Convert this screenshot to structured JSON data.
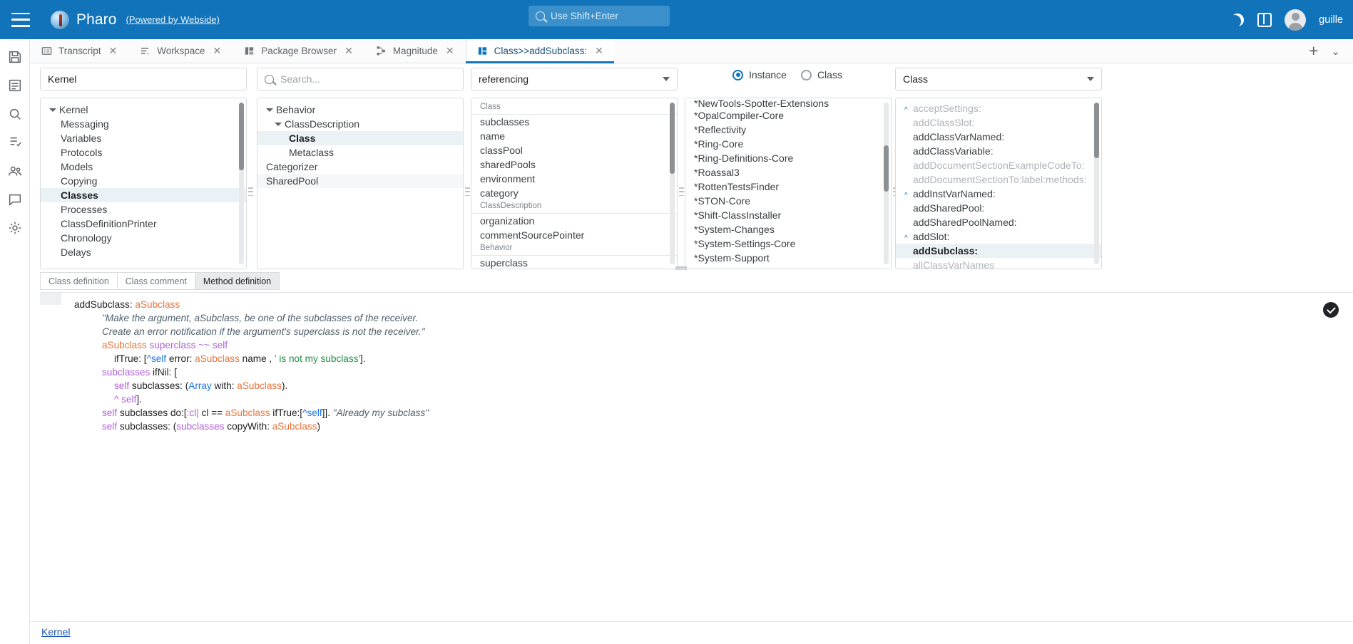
{
  "topbar": {
    "menu_icon": "hamburger-icon",
    "brand": "Pharo",
    "brand_sub": "(Powered by Webside)",
    "search_placeholder": "Use Shift+Enter",
    "dark_mode_icon": "moon-icon",
    "layout_icon": "split-pane-icon",
    "username": "guille"
  },
  "rail": {
    "items": [
      {
        "name": "save-icon",
        "label": "Save"
      },
      {
        "name": "book-icon",
        "label": "Changes"
      },
      {
        "name": "search-icon",
        "label": "Search"
      },
      {
        "name": "test-runner-icon",
        "label": "Test Runner"
      },
      {
        "name": "users-icon",
        "label": "Peers"
      },
      {
        "name": "chat-icon",
        "label": "Chat"
      },
      {
        "name": "gear-icon",
        "label": "Settings"
      }
    ]
  },
  "tabs": {
    "items": [
      {
        "label": "Transcript",
        "icon": "transcript-icon",
        "active": false
      },
      {
        "label": "Workspace",
        "icon": "workspace-icon",
        "active": false
      },
      {
        "label": "Package Browser",
        "icon": "package-browser-icon",
        "active": false
      },
      {
        "label": "Magnitude",
        "icon": "hierarchy-icon",
        "active": false
      },
      {
        "label": "Class>>addSubclass:",
        "icon": "class-browser-icon",
        "active": true
      }
    ],
    "close_label": "✕",
    "add_label": "+",
    "overflow_label": "⌄"
  },
  "browser": {
    "package_filter": {
      "value": "Kernel"
    },
    "class_search": {
      "value": "",
      "placeholder": "Search..."
    },
    "category_select": {
      "value": "referencing"
    },
    "side_select": {
      "value": "Class"
    },
    "side_options": [
      "Class",
      "Instance"
    ],
    "scope": {
      "instance_label": "Instance",
      "class_label": "Class",
      "selected": "Instance"
    },
    "packages": {
      "root": "Kernel",
      "items": [
        {
          "label": "Kernel",
          "level": 0,
          "expanded": true,
          "selected": false
        },
        {
          "label": "Messaging",
          "level": 1,
          "selected": false
        },
        {
          "label": "Variables",
          "level": 1,
          "selected": false
        },
        {
          "label": "Protocols",
          "level": 1,
          "selected": false
        },
        {
          "label": "Models",
          "level": 1,
          "selected": false
        },
        {
          "label": "Copying",
          "level": 1,
          "selected": false
        },
        {
          "label": "Classes",
          "level": 1,
          "selected": true
        },
        {
          "label": "Processes",
          "level": 1,
          "selected": false
        },
        {
          "label": "ClassDefinitionPrinter",
          "level": 1,
          "selected": false
        },
        {
          "label": "Chronology",
          "level": 1,
          "selected": false
        },
        {
          "label": "Delays",
          "level": 1,
          "selected": false
        }
      ]
    },
    "classes": {
      "items": [
        {
          "label": "Behavior",
          "level": 0,
          "expanded": true,
          "selected": false,
          "alt": false
        },
        {
          "label": "ClassDescription",
          "level": 1,
          "expanded": true,
          "selected": false,
          "alt": false
        },
        {
          "label": "Class",
          "level": 2,
          "selected": true,
          "alt": false
        },
        {
          "label": "Metaclass",
          "level": 2,
          "selected": false,
          "alt": false
        },
        {
          "label": "Categorizer",
          "level": 0,
          "selected": false,
          "alt": false
        },
        {
          "label": "SharedPool",
          "level": 0,
          "selected": false,
          "alt": true
        }
      ]
    },
    "variables": {
      "items": [
        {
          "label": "Class",
          "type": "header"
        },
        {
          "label": "subclasses",
          "type": "item"
        },
        {
          "label": "name",
          "type": "item"
        },
        {
          "label": "classPool",
          "type": "item"
        },
        {
          "label": "sharedPools",
          "type": "item"
        },
        {
          "label": "environment",
          "type": "item"
        },
        {
          "label": "category",
          "type": "item"
        },
        {
          "label": "ClassDescription",
          "type": "header"
        },
        {
          "label": "organization",
          "type": "item"
        },
        {
          "label": "commentSourcePointer",
          "type": "item"
        },
        {
          "label": "Behavior",
          "type": "header"
        },
        {
          "label": "superclass",
          "type": "item"
        }
      ]
    },
    "categories": {
      "items": [
        {
          "label": "*NewTools-Spotter-Extensions"
        },
        {
          "label": "*OpalCompiler-Core"
        },
        {
          "label": "*Reflectivity"
        },
        {
          "label": "*Ring-Core"
        },
        {
          "label": "*Ring-Definitions-Core"
        },
        {
          "label": "*Roassal3"
        },
        {
          "label": "*RottenTestsFinder"
        },
        {
          "label": "*STON-Core"
        },
        {
          "label": "*Shift-ClassInstaller"
        },
        {
          "label": "*System-Changes"
        },
        {
          "label": "*System-Settings-Core"
        },
        {
          "label": "*System-Support"
        }
      ]
    },
    "methods": {
      "items": [
        {
          "label": "acceptSettings:",
          "dim": true,
          "marker": "^"
        },
        {
          "label": "addClassSlot:",
          "dim": true,
          "marker": ""
        },
        {
          "label": "addClassVarNamed:",
          "dim": false,
          "marker": ""
        },
        {
          "label": "addClassVariable:",
          "dim": false,
          "marker": ""
        },
        {
          "label": "addDocumentSectionExampleCodeTo:",
          "dim": true,
          "marker": ""
        },
        {
          "label": "addDocumentSectionTo:label:methods:",
          "dim": true,
          "marker": ""
        },
        {
          "label": "addInstVarNamed:",
          "dim": false,
          "marker": "^"
        },
        {
          "label": "addSharedPool:",
          "dim": false,
          "marker": ""
        },
        {
          "label": "addSharedPoolNamed:",
          "dim": false,
          "marker": ""
        },
        {
          "label": "addSlot:",
          "dim": false,
          "marker": "^"
        },
        {
          "label": "addSubclass:",
          "dim": false,
          "marker": "",
          "selected": true
        },
        {
          "label": "allClassVarNames",
          "dim": true,
          "marker": ""
        }
      ]
    }
  },
  "editor": {
    "tabs": [
      {
        "label": "Class definition",
        "active": false
      },
      {
        "label": "Class comment",
        "active": false
      },
      {
        "label": "Method definition",
        "active": true
      }
    ],
    "accept_icon": "accept-check-icon",
    "status_link": "Kernel",
    "source": {
      "line1_sel": "addSubclass: ",
      "line1_arg": "aSubclass",
      "line2": "\"Make the argument, aSubclass, be one of the subclasses of the receiver.",
      "line3": "Create an error notification if the argument's superclass is not the receiver.\"",
      "line4_a": "aSubclass",
      "line4_b": " superclass ",
      "line4_c": "~~",
      "line4_d": " self",
      "line5_a": "ifTrue: [",
      "line5_b": "^self",
      "line5_c": " error: ",
      "line5_d": "aSubclass",
      "line5_e": " name , ",
      "line5_f": "' is not my subclass'",
      "line5_g": "].",
      "line6_a": "subclasses",
      "line6_b": " ifNil: [",
      "line7_a": "self",
      "line7_b": " subclasses: (",
      "line7_c": "Array",
      "line7_d": " with: ",
      "line7_e": "aSubclass",
      "line7_f": ").",
      "line8_a": "^ self",
      "line8_b": "].",
      "line9_a": "self",
      "line9_b": " subclasses do:[",
      "line9_c": ":cl|",
      "line9_d": " cl == ",
      "line9_e": "aSubclass",
      "line9_f": " ifTrue:[",
      "line9_g": "^self",
      "line9_h": "]]. ",
      "line9_i": "\"Already my subclass\"",
      "line10_a": "self",
      "line10_b": " subclasses: (",
      "line10_c": "subclasses",
      "line10_d": " copyWith: ",
      "line10_e": "aSubclass",
      "line10_f": ")"
    }
  },
  "colors": {
    "brand_blue": "#1173ba",
    "selection": "#eaf2f6",
    "argument": "#e8743b",
    "keyword": "#b061d9",
    "string": "#1e8e3e",
    "comment": "#4f5e6b",
    "link": "#1a56a8"
  }
}
